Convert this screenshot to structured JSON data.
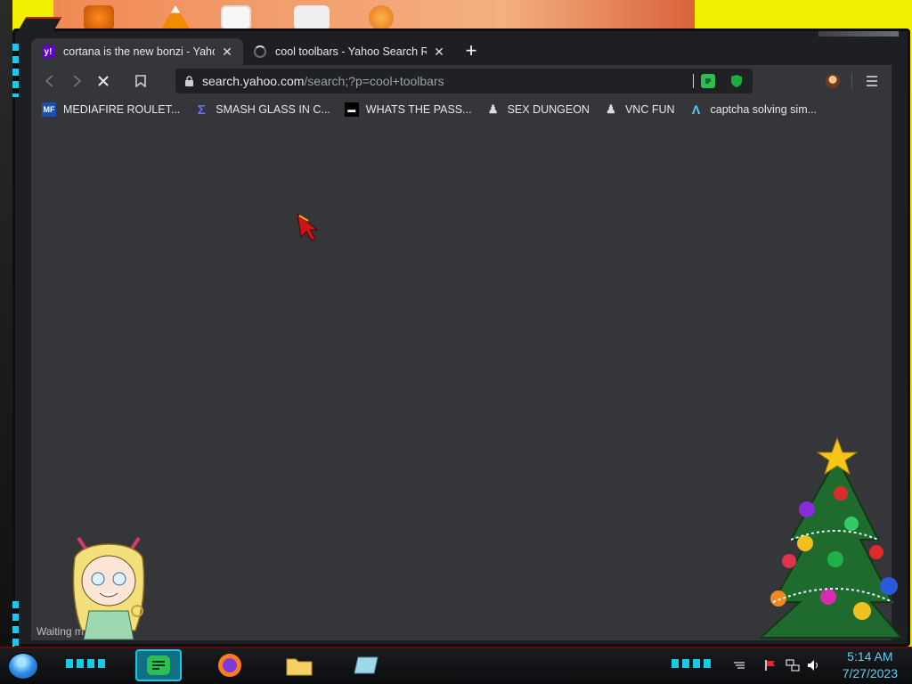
{
  "browser": {
    "tabs": [
      {
        "title": "cortana is the new bonzi - Yahoo S",
        "favicon": "y!",
        "active": true,
        "loading": false
      },
      {
        "title": "cool toolbars - Yahoo Search Resu",
        "favicon": "",
        "active": false,
        "loading": true
      }
    ],
    "new_tab": "+",
    "close_glyph": "✕",
    "url": {
      "host": "search.yahoo.com",
      "path": "/search;?p=cool+toolbars"
    },
    "bookmarks": [
      {
        "label": "MEDIAFIRE ROULET...",
        "icon": "MF"
      },
      {
        "label": "SMASH GLASS IN C...",
        "icon": "Σ"
      },
      {
        "label": "WHATS THE PASS...",
        "icon": "▬"
      },
      {
        "label": "SEX DUNGEON",
        "icon": "♟"
      },
      {
        "label": "VNC FUN",
        "icon": "♟"
      },
      {
        "label": "captcha solving sim...",
        "icon": "Λ"
      }
    ],
    "status_text": "Waiting                    m..."
  },
  "taskbar": {
    "clock_time": "5:14 AM",
    "clock_date": "7/27/2023"
  },
  "colors": {
    "accent": "#19c9ea",
    "yahoo": "#6001d2",
    "window_bg": "#35363a"
  }
}
